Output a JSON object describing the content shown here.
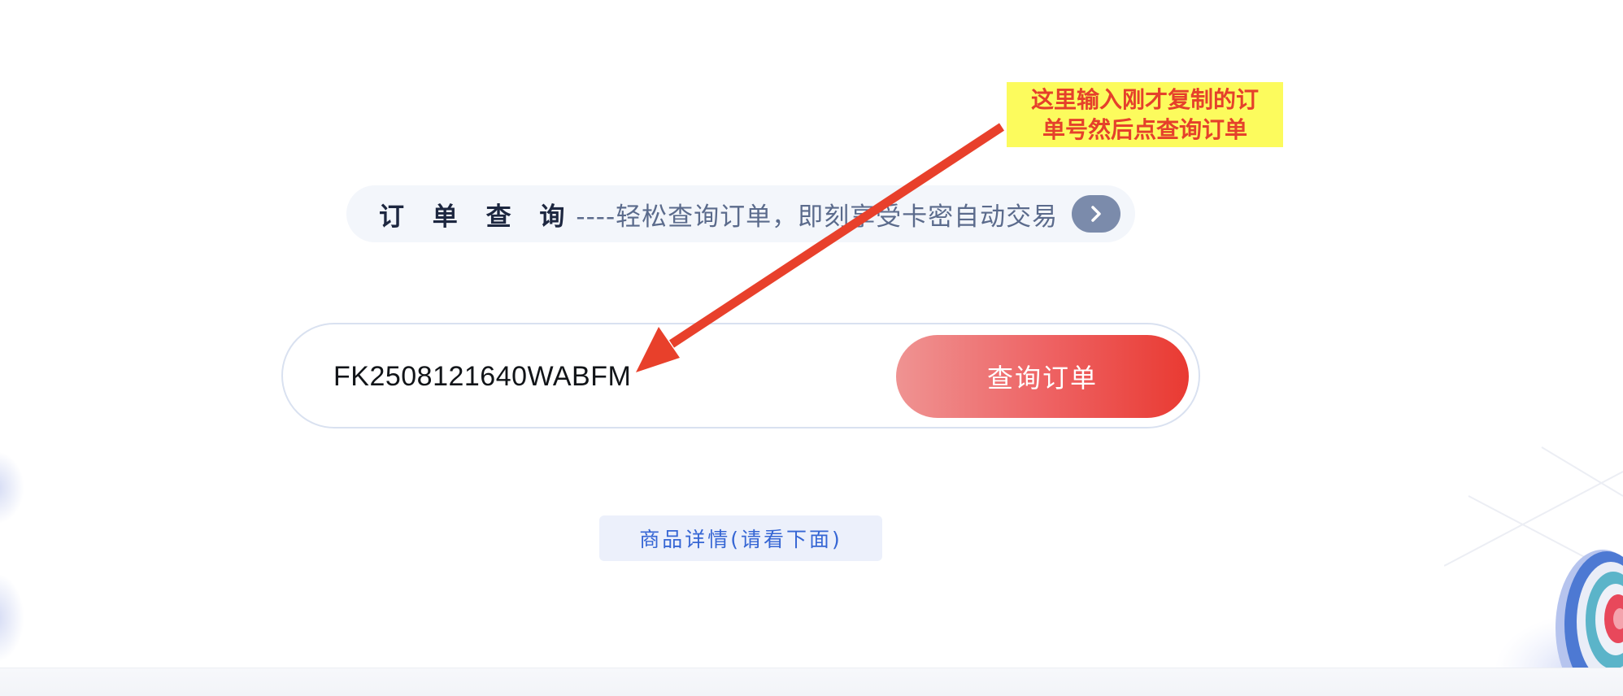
{
  "banner": {
    "title": "订 单 查 询",
    "subtitle": "----轻松查询订单，即刻享受卡密自动交易",
    "arrow_icon": "chevron-right-icon"
  },
  "search": {
    "value": "FK2508121640WABFM",
    "button_label": "查询订单"
  },
  "detail": {
    "label": "商品详情(请看下面)"
  },
  "annotation": {
    "line1": "这里输入刚才复制的订",
    "line2": "单号然后点查询订单"
  },
  "colors": {
    "accent_start": "#ef9392",
    "accent_end": "#e93a32",
    "annotation_bg": "#fcfb5d",
    "annotation_text": "#e5402b",
    "link_blue": "#3666d4"
  }
}
